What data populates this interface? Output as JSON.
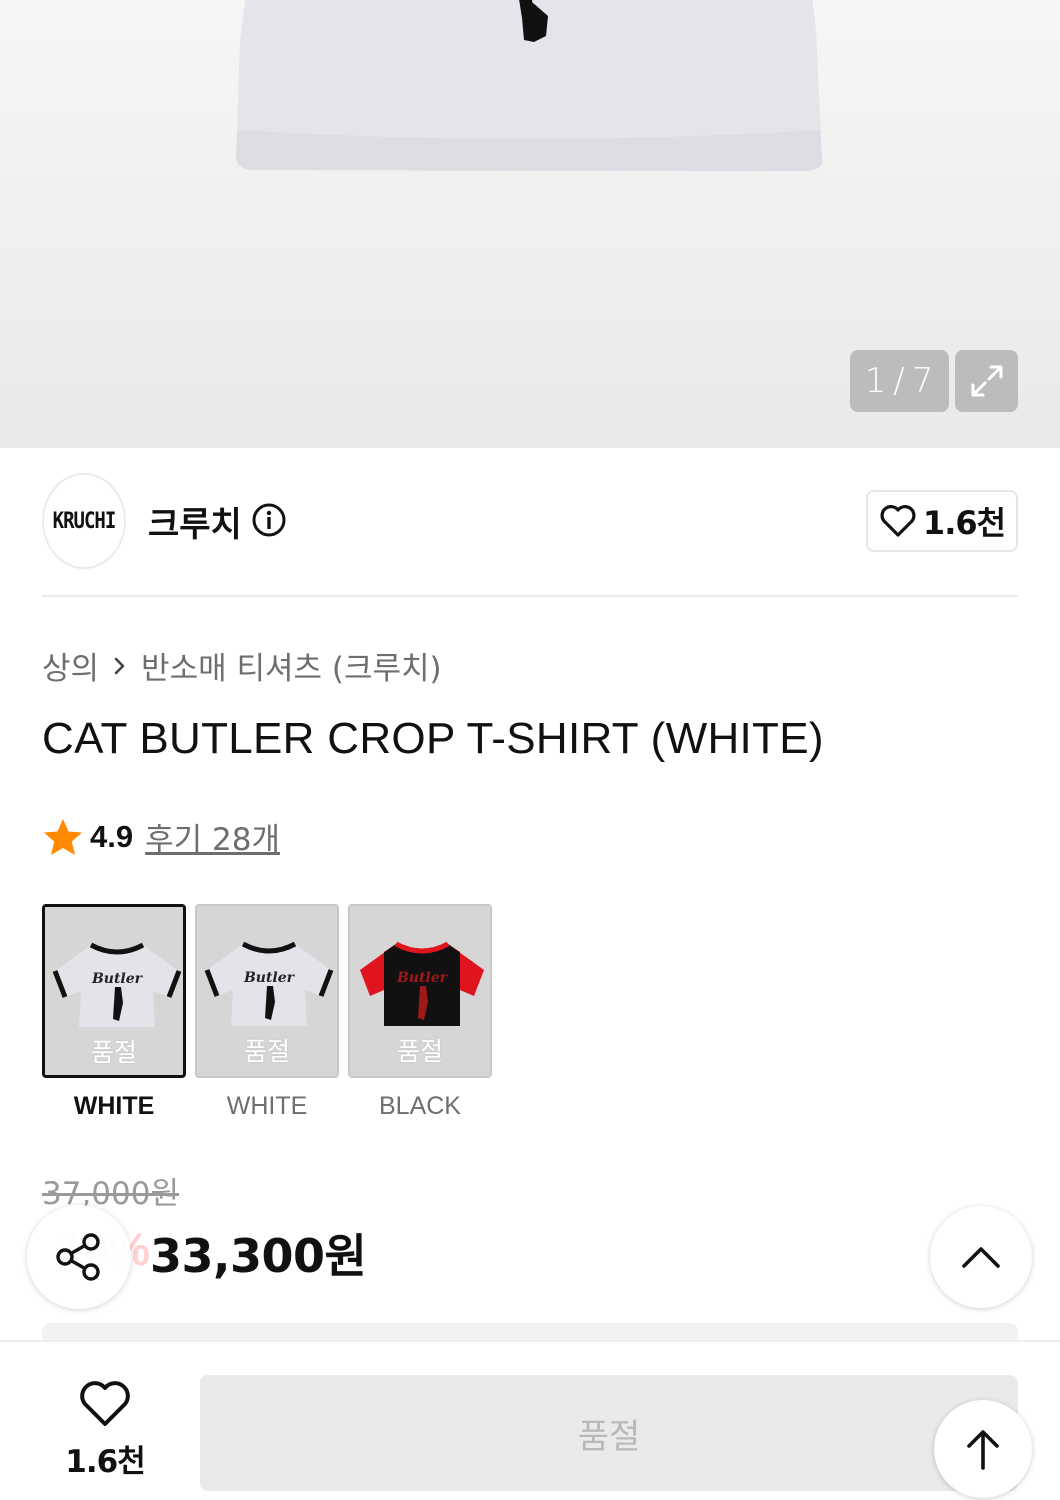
{
  "gallery": {
    "current": "1",
    "separator": "/",
    "total": "7",
    "expand_icon": "expand-arrows-icon"
  },
  "brand": {
    "logo_text": "KRUCHI",
    "name": "크루치",
    "info_icon": "info-icon",
    "like_count": "1.6천"
  },
  "product": {
    "breadcrumb": [
      "상의",
      "반소매 티셔츠 (크루치)"
    ],
    "title": "CAT BUTLER CROP T-SHIRT (WHITE)",
    "rating": "4.9",
    "review_link": "후기 28개",
    "star_color": "#ff8a00"
  },
  "options": [
    {
      "name": "WHITE",
      "status": "품절",
      "selected": true,
      "body_color": "#e3e3e9",
      "trim_color": "#111111"
    },
    {
      "name": "WHITE",
      "status": "품절",
      "selected": false,
      "body_color": "#e3e3e9",
      "trim_color": "#111111"
    },
    {
      "name": "BLACK",
      "status": "품절",
      "selected": false,
      "body_color": "#111111",
      "trim_color": "#e0141e"
    }
  ],
  "price": {
    "original": "37,000원",
    "discount": "10%",
    "sale": "33,300원",
    "discount_color": "#ff4b4b"
  },
  "bottom_bar": {
    "wish_count": "1.6천",
    "action_label": "품절"
  }
}
